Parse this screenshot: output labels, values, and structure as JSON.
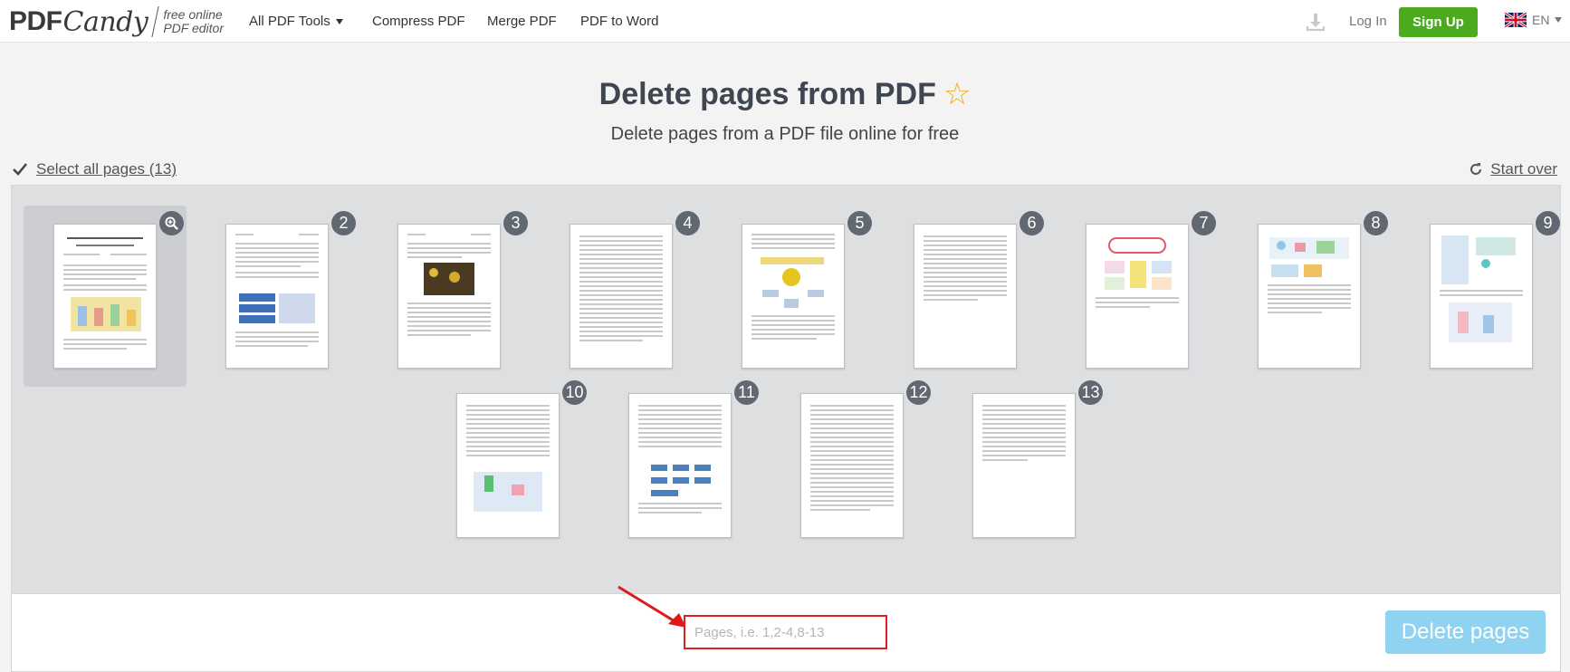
{
  "header": {
    "logo_pdf": "PDF",
    "logo_candy": "Candy",
    "tagline_1": "free online",
    "tagline_2": "PDF editor",
    "nav": [
      "All PDF Tools",
      "Compress PDF",
      "Merge PDF",
      "PDF to Word"
    ],
    "login": "Log In",
    "signup": "Sign Up",
    "lang": "EN"
  },
  "main": {
    "title": "Delete pages from PDF",
    "subtitle": "Delete pages from a PDF file online for free",
    "select_all": "Select all pages (13)",
    "start_over": "Start over"
  },
  "pages": {
    "numbers": [
      "2",
      "3",
      "4",
      "5",
      "6",
      "7",
      "8",
      "9",
      "10",
      "11",
      "12",
      "13"
    ]
  },
  "footer": {
    "input_placeholder": "Pages, i.e. 1,2-4,8-13",
    "input_value": "",
    "delete_button": "Delete pages"
  },
  "colors": {
    "accent_green": "#4caa1f",
    "delete_button": "#8fd3f0",
    "badge": "#616871",
    "star": "#f0ad17",
    "highlight_border": "#e02020"
  }
}
